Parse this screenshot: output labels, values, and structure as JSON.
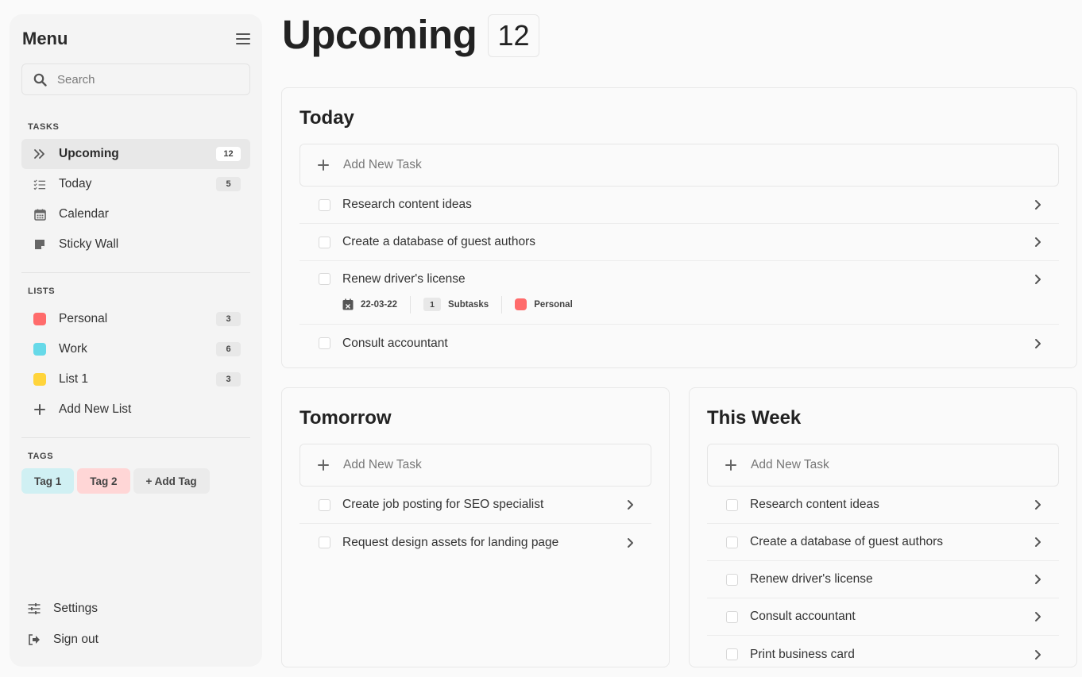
{
  "sidebar": {
    "title": "Menu",
    "search_placeholder": "Search",
    "tasks_label": "TASKS",
    "task_items": [
      {
        "label": "Upcoming",
        "count": "12"
      },
      {
        "label": "Today",
        "count": "5"
      },
      {
        "label": "Calendar",
        "count": ""
      },
      {
        "label": "Sticky Wall",
        "count": ""
      }
    ],
    "lists_label": "LISTS",
    "list_items": [
      {
        "label": "Personal",
        "count": "3",
        "color": "#ff6b6b"
      },
      {
        "label": "Work",
        "count": "6",
        "color": "#66d9e8"
      },
      {
        "label": "List 1",
        "count": "3",
        "color": "#ffd43b"
      }
    ],
    "add_list_label": "Add New List",
    "tags_label": "TAGS",
    "tags": [
      {
        "label": "Tag 1",
        "color": "#d0f0f3"
      },
      {
        "label": "Tag 2",
        "color": "#ffd6d6"
      },
      {
        "label": "+ Add Tag",
        "color": "#ebebeb"
      }
    ],
    "settings_label": "Settings",
    "signout_label": "Sign out"
  },
  "main": {
    "title": "Upcoming",
    "count": "12",
    "add_task_label": "Add New Task",
    "today": {
      "heading": "Today",
      "tasks": [
        "Research content ideas",
        "Create a database of guest authors",
        "Renew driver's license",
        "Consult accountant"
      ],
      "meta": {
        "date": "22-03-22",
        "subtask_count": "1",
        "subtask_label": "Subtasks",
        "list_label": "Personal",
        "list_color": "#ff6b6b"
      }
    },
    "tomorrow": {
      "heading": "Tomorrow",
      "tasks": [
        "Create job posting for SEO specialist",
        "Request design assets for landing page"
      ]
    },
    "week": {
      "heading": "This Week",
      "tasks": [
        "Research content ideas",
        "Create a database of guest authors",
        "Renew driver's license",
        "Consult accountant",
        "Print business card"
      ]
    }
  }
}
